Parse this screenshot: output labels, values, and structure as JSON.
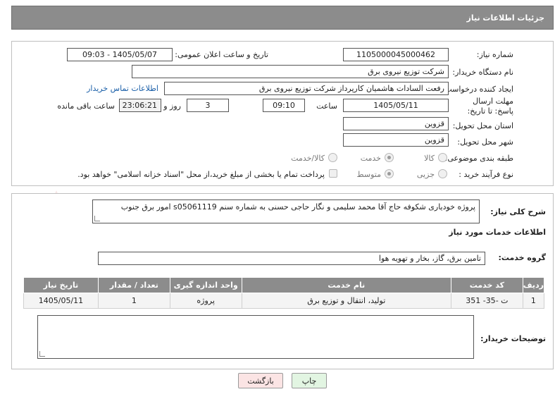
{
  "header": {
    "title": "جزئیات اطلاعات نیاز"
  },
  "form": {
    "need_number_label": "شماره نیاز:",
    "need_number": "1105000045000462",
    "announce_datetime_label": "تاریخ و ساعت اعلان عمومی:",
    "announce_datetime": "1405/05/07 - 09:03",
    "buyer_org_label": "نام دستگاه خریدار:",
    "buyer_org": "شرکت توزیع نیروی برق",
    "requester_label": "ایجاد کننده درخواست:",
    "requester": "رفعت السادات هاشمیان کارپرداز شرکت توزیع نیروی برق",
    "buyer_contact_link": "اطلاعات تماس خریدار",
    "deadline_label": "مهلت ارسال پاسخ: تا تاریخ:",
    "deadline_date": "1405/05/11",
    "time_label": "ساعت",
    "deadline_time": "09:10",
    "days_count": "3",
    "days_label": "روز و",
    "remaining_time": "23:06:21",
    "remaining_label": "ساعت باقی مانده",
    "delivery_province_label": "استان محل تحویل:",
    "delivery_province": "قزوین",
    "delivery_city_label": "شهر محل تحویل:",
    "delivery_city": "قزوین",
    "category_label": "طبقه بندی موضوعی:",
    "category_options": [
      "کالا",
      "خدمت",
      "کالا/خدمت"
    ],
    "category_selected": "خدمت",
    "process_label": "نوع فرآیند خرید :",
    "process_options": [
      "جزیی",
      "متوسط"
    ],
    "process_selected": "متوسط",
    "payment_note": "پرداخت تمام یا بخشی از مبلغ خرید،از محل \"اسناد خزانه اسلامی\" خواهد بود."
  },
  "details": {
    "description_label": "شرح کلی نیاز:",
    "description": "پروژه خودیاری شکوفه حاج آقا محمد سلیمی و نگار حاجی حسنی به شماره سنم s05061119 امور برق جنوب",
    "services_title": "اطلاعات خدمات مورد نیاز",
    "service_group_label": "گروه خدمت:",
    "service_group": "تامین برق، گاز، بخار و تهویه هوا",
    "table": {
      "headers": [
        "ردیف",
        "کد خدمت",
        "نام خدمت",
        "واحد اندازه گیری",
        "تعداد / مقدار",
        "تاریخ نیاز"
      ],
      "rows": [
        [
          "1",
          "ت -35- 351",
          "تولید، انتقال و توزیع برق",
          "پروژه",
          "1",
          "1405/05/11"
        ]
      ]
    },
    "buyer_notes_label": "توضیحات خریدار:",
    "buyer_notes": ""
  },
  "buttons": {
    "print": "چاپ",
    "back": "بازگشت"
  },
  "watermark": {
    "text": "AriaTender.net"
  },
  "colors": {
    "header_bg": "#8c8c8c",
    "link": "#1a5fa8",
    "print_btn": "#e2f5e2",
    "back_btn": "#fbe4e4"
  }
}
